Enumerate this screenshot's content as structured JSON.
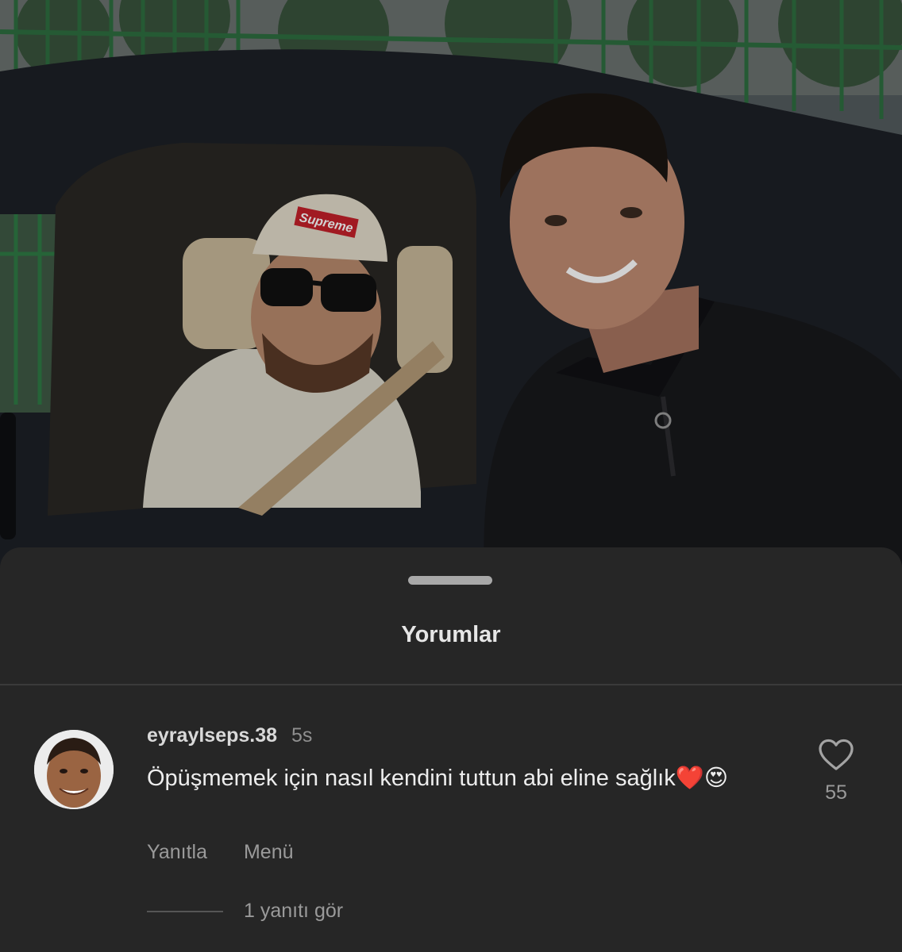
{
  "photo": {
    "cap_logo": "Supreme",
    "icon": "photo-background"
  },
  "sheet": {
    "title": "Yorumlar"
  },
  "comment": {
    "username": "eyraylseps.38",
    "time": "5s",
    "text": "Öpüşmemek için nasıl kendini tuttun abi eline sağlık❤️😍",
    "likes": "55",
    "like_icon": "heart-outline-icon",
    "reply_label": "Yanıtla",
    "menu_label": "Menü",
    "view_replies": "1 yanıtı gör"
  },
  "colors": {
    "sheet_bg": "#262626",
    "text_primary": "#ededed",
    "text_secondary": "#9a9a9a"
  }
}
